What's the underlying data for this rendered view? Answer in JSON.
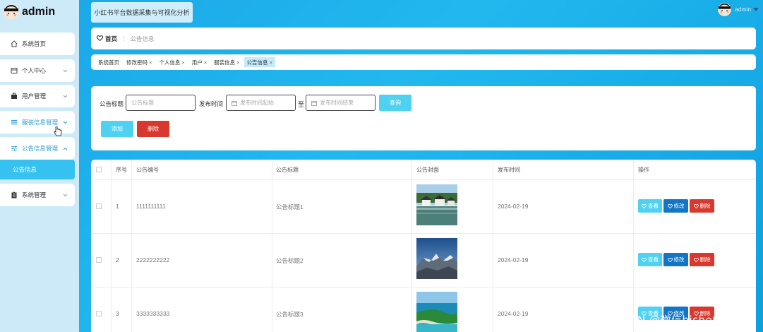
{
  "app": {
    "logo_text": "admin",
    "system_title": "小红书平台数据采集与可视化分析",
    "user_name": "admin"
  },
  "sidebar": {
    "items": [
      {
        "label": "系统首页",
        "icon": "home-icon"
      },
      {
        "label": "个人中心",
        "icon": "profile-icon",
        "has_chevron": true
      },
      {
        "label": "用户管理",
        "icon": "briefcase-icon",
        "has_chevron": true
      },
      {
        "label": "服装信息管理",
        "icon": "list-icon",
        "has_chevron": true
      },
      {
        "label": "公告信息管理",
        "icon": "sliders-icon",
        "has_chevron": true,
        "expanded": true
      },
      {
        "label": "系统管理",
        "icon": "clipboard-icon",
        "has_chevron": true
      }
    ],
    "sub_item": "公告信息"
  },
  "breadcrumb": {
    "home": "首页",
    "current": "公告信息"
  },
  "tabs": [
    {
      "label": "系统首页",
      "closable": false
    },
    {
      "label": "修改密码",
      "closable": true
    },
    {
      "label": "个人信息",
      "closable": true
    },
    {
      "label": "用户",
      "closable": true
    },
    {
      "label": "服装信息",
      "closable": true
    },
    {
      "label": "公告信息",
      "closable": true,
      "active": true
    }
  ],
  "filter": {
    "title_label": "公告标题",
    "title_placeholder": "公告标题",
    "time_label": "发布时间",
    "start_placeholder": "发布时间起始",
    "range_sep": "至",
    "end_placeholder": "发布时间结束",
    "query_button": "查询",
    "add_button": "添加",
    "delete_button": "删除"
  },
  "table": {
    "headers": [
      "序号",
      "公告编号",
      "公告标题",
      "公告封面",
      "发布时间",
      "操作"
    ],
    "rows": [
      {
        "index": "1",
        "code": "1111111111",
        "title": "公告标题1",
        "date": "2024-02-19"
      },
      {
        "index": "2",
        "code": "2222222222",
        "title": "公告标题2",
        "date": "2024-02-19"
      },
      {
        "index": "3",
        "code": "3333333333",
        "title": "公告标题3",
        "date": "2024-02-19"
      }
    ],
    "actions": {
      "view": "查看",
      "edit": "修改",
      "delete": "删除"
    }
  },
  "watermark": "CSDN @微信bishe911",
  "colors": {
    "primary_light": "#4fd2f2",
    "primary_dark": "#1275c5",
    "danger": "#d9382f",
    "sidebar_bg": "#cdeaf8",
    "content_bg": "#1aa6e8"
  }
}
